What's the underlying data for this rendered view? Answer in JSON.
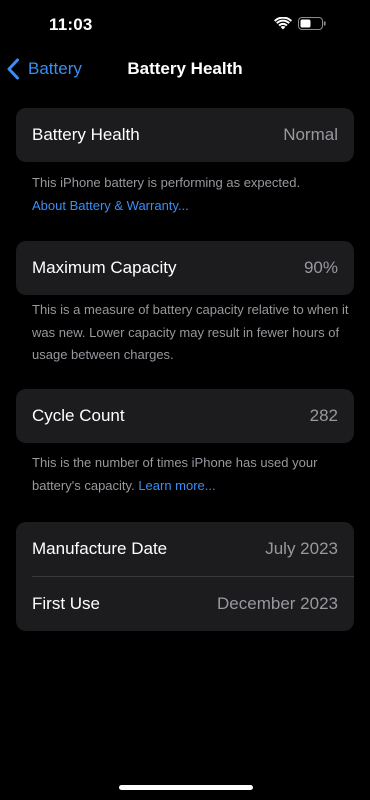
{
  "status_bar": {
    "time": "11:03",
    "wifi_icon": "wifi-icon",
    "battery_icon": "battery-icon"
  },
  "nav": {
    "back_label": "Battery",
    "back_icon": "chevron-left-icon",
    "title": "Battery Health"
  },
  "health": {
    "label": "Battery Health",
    "value": "Normal",
    "description": "This iPhone battery is performing as expected.",
    "link": "About Battery & Warranty..."
  },
  "capacity": {
    "label": "Maximum Capacity",
    "value": "90%",
    "description": "This is a measure of battery capacity relative to when it was new. Lower capacity may result in fewer hours of usage between charges."
  },
  "cycle": {
    "label": "Cycle Count",
    "value": "282",
    "description": "This is the number of times iPhone has used your battery's capacity.",
    "link": "Learn more..."
  },
  "dates": {
    "manufacture_label": "Manufacture Date",
    "manufacture_value": "July 2023",
    "first_use_label": "First Use",
    "first_use_value": "December 2023"
  },
  "colors": {
    "background": "#000000",
    "card": "#1c1c1e",
    "accent": "#3a8ef5",
    "secondary_text": "#98989e"
  }
}
